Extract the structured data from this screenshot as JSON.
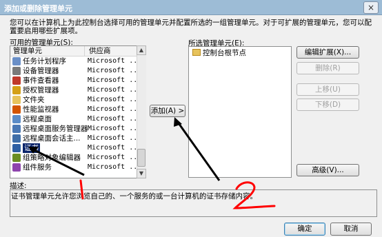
{
  "window": {
    "title": "添加或删除管理单元",
    "close_glyph": "×"
  },
  "intro_text": "您可以在计算机上为此控制台选择可用的管理单元并配置所选的一组管理单元。对于可扩展的管理单元，您可以配置要启用哪些扩展项。",
  "available": {
    "label": "可用的管理单元(S):",
    "columns": {
      "name": "管理单元",
      "vendor": "供应商"
    },
    "items": [
      {
        "name": "任务计划程序",
        "vendor": "Microsoft ...",
        "icon": "task-scheduler-icon",
        "color": "#6a8fc7"
      },
      {
        "name": "设备管理器",
        "vendor": "Microsoft ...",
        "icon": "device-manager-icon",
        "color": "#7a7a7a"
      },
      {
        "name": "事件查看器",
        "vendor": "Microsoft ...",
        "icon": "event-viewer-icon",
        "color": "#c0392b"
      },
      {
        "name": "授权管理器",
        "vendor": "Microsoft ...",
        "icon": "authorization-manager-icon",
        "color": "#d4a017"
      },
      {
        "name": "文件夹",
        "vendor": "Microsoft ...",
        "icon": "folder-icon",
        "color": "#e7c35c"
      },
      {
        "name": "性能监视器",
        "vendor": "Microsoft ...",
        "icon": "performance-monitor-icon",
        "color": "#d35400"
      },
      {
        "name": "远程桌面",
        "vendor": "Microsoft ...",
        "icon": "remote-desktop-icon",
        "color": "#5b8cc8"
      },
      {
        "name": "远程桌面服务管理器",
        "vendor": "Microsoft ...",
        "icon": "remote-desktop-services-icon",
        "color": "#4a78b5"
      },
      {
        "name": "远程桌面会话主...",
        "vendor": "Microsoft ...",
        "icon": "remote-desktop-session-icon",
        "color": "#3f6ea8"
      },
      {
        "name": "证书",
        "vendor": "Microsoft ...",
        "icon": "certificate-icon",
        "color": "#2e5fa3",
        "selected": true
      },
      {
        "name": "组策略对象编辑器",
        "vendor": "Microsoft ...",
        "icon": "group-policy-icon",
        "color": "#6b8e23"
      },
      {
        "name": "组件服务",
        "vendor": "Microsoft ...",
        "icon": "component-services-icon",
        "color": "#8e44ad"
      }
    ]
  },
  "add_button": {
    "label": "添加(A) >"
  },
  "selected": {
    "label": "所选管理单元(E):",
    "items": [
      {
        "name": "控制台根节点",
        "icon": "folder-icon"
      }
    ]
  },
  "side_buttons": {
    "edit_extensions": "编辑扩展(X)...",
    "remove": "删除(R)",
    "move_up": "上移(U)",
    "move_down": "下移(D)",
    "advanced": "高级(V)..."
  },
  "description": {
    "label": "描述:",
    "text": "证书管理单元允许您浏览自己的、一个服务的或一台计算机的证书存储内容。"
  },
  "footer": {
    "ok": "确定",
    "cancel": "取消"
  },
  "annotations": {
    "color": "#ff0000",
    "marks": [
      "1",
      "2"
    ]
  }
}
